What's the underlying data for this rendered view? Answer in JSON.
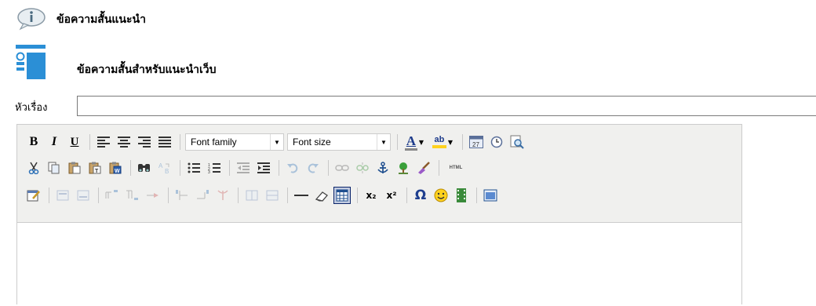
{
  "header": {
    "title": "ข้อความสั้นแนะนำ",
    "subtitle": "ข้อความสั้นสำหรับแนะนำเว็บ"
  },
  "form": {
    "subject_label": "หัวเรื่อง",
    "subject_value": ""
  },
  "toolbar": {
    "row1": {
      "bold": "B",
      "italic": "I",
      "underline": "U",
      "font_family": "Font family",
      "font_size": "Font size",
      "font_color_glyph": "A",
      "highlight_glyph": "ab"
    },
    "row2": {
      "html_label": "HTML"
    },
    "row3": {
      "subscript": "x₂",
      "superscript": "x²",
      "omega": "Ω"
    }
  },
  "colors": {
    "editor_bg": "#f0f0ee",
    "border": "#cccccc",
    "accent_blue": "#2b8fd6",
    "smile_yellow": "#ffd21f"
  },
  "icons": [
    "info-icon",
    "layout-icon",
    "align-left-icon",
    "align-center-icon",
    "align-right-icon",
    "align-justify-icon",
    "cut-icon",
    "copy-icon",
    "paste-icon",
    "paste-text-icon",
    "paste-word-icon",
    "search-icon",
    "replace-icon",
    "bullet-list-icon",
    "numbered-list-icon",
    "outdent-icon",
    "indent-icon",
    "undo-icon",
    "redo-icon",
    "link-icon",
    "unlink-icon",
    "anchor-icon",
    "image-icon",
    "cleanup-icon",
    "table-icon",
    "emotion-icon",
    "media-icon",
    "fullscreen-icon"
  ]
}
